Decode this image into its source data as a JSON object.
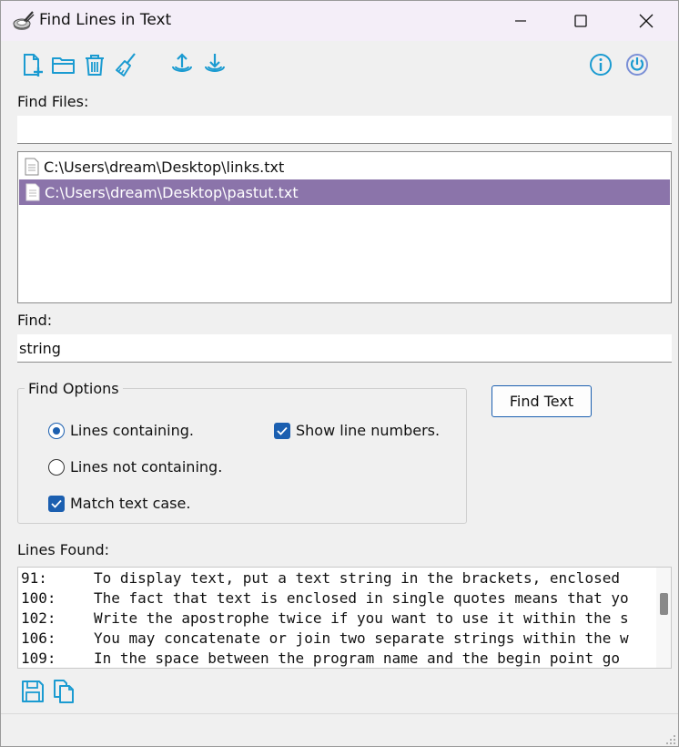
{
  "window": {
    "title": "Find Lines in Text"
  },
  "toolbar": {
    "icons": [
      "new-file-icon",
      "open-folder-icon",
      "trash-icon",
      "broom-icon",
      "upload-icon",
      "download-icon",
      "info-icon",
      "power-icon"
    ]
  },
  "find_files": {
    "label": "Find Files:",
    "value": "",
    "files": [
      {
        "path": "C:\\Users\\dream\\Desktop\\links.txt",
        "selected": false
      },
      {
        "path": "C:\\Users\\dream\\Desktop\\pastut.txt",
        "selected": true
      }
    ]
  },
  "find": {
    "label": "Find:",
    "value": "string"
  },
  "options": {
    "title": "Find Options",
    "lines_containing": "Lines containing.",
    "lines_not_containing": "Lines not containing.",
    "match_case": "Match text case.",
    "show_line_numbers": "Show line numbers."
  },
  "find_button": "Find Text",
  "results": {
    "label": "Lines Found:",
    "rows": [
      {
        "num": "91:",
        "text": "To display text, put a text string in the brackets, enclosed"
      },
      {
        "num": "100:",
        "text": "The fact that text is enclosed in single quotes means that yo"
      },
      {
        "num": "102:",
        "text": "Write the apostrophe twice if you want to use it within the s"
      },
      {
        "num": "106:",
        "text": "You may concatenate or join two separate strings within the w"
      },
      {
        "num": "109:",
        "text": "In the space between the program name and the begin point go"
      }
    ]
  },
  "colors": {
    "accent": "#1b9bd1",
    "selection": "#8b74aa",
    "checkbox": "#1b5fb0"
  }
}
